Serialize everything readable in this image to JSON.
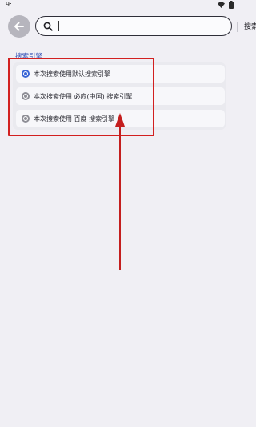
{
  "status_bar": {
    "time": "9:11",
    "icons": [
      "wifi-icon",
      "battery-icon"
    ]
  },
  "header": {
    "back_icon": "arrow-left-icon",
    "search": {
      "icon": "search-icon",
      "value": "",
      "placeholder": "",
      "button_label": "搜索"
    }
  },
  "section": {
    "title": "搜索引擎",
    "options": [
      {
        "label": "本次搜索使用默认搜索引擎",
        "selected": true
      },
      {
        "label": "本次搜索使用 必应(中国) 搜索引擎",
        "selected": false
      },
      {
        "label": "本次搜索使用 百度 搜索引擎",
        "selected": false
      }
    ]
  },
  "colors": {
    "accent": "#3a66d6",
    "annotation": "#d22020",
    "background": "#f0eff4"
  }
}
